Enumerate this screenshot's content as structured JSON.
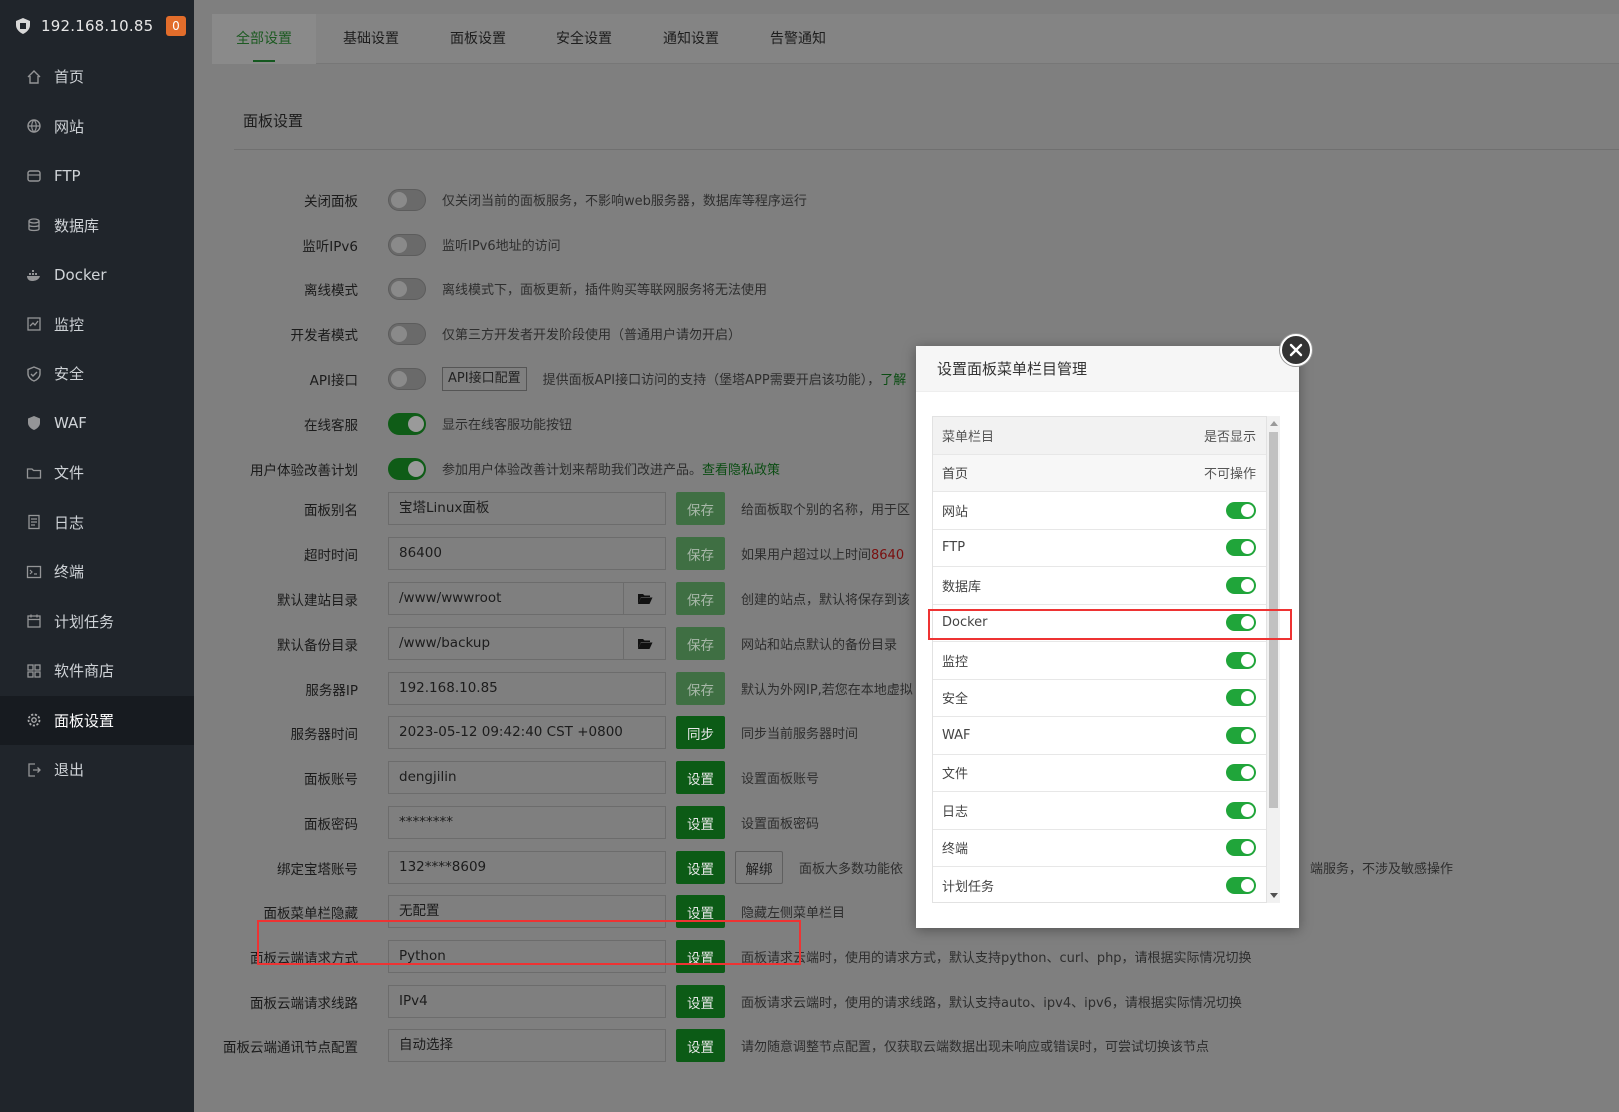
{
  "sidebar": {
    "host": "192.168.10.85",
    "badge": "0",
    "items": [
      {
        "label": "首页",
        "icon": "home-icon"
      },
      {
        "label": "网站",
        "icon": "globe-icon"
      },
      {
        "label": "FTP",
        "icon": "ftp-icon"
      },
      {
        "label": "数据库",
        "icon": "database-icon"
      },
      {
        "label": "Docker",
        "icon": "docker-icon"
      },
      {
        "label": "监控",
        "icon": "monitor-icon"
      },
      {
        "label": "安全",
        "icon": "shield-icon"
      },
      {
        "label": "WAF",
        "icon": "waf-icon"
      },
      {
        "label": "文件",
        "icon": "folder-icon"
      },
      {
        "label": "日志",
        "icon": "log-icon"
      },
      {
        "label": "终端",
        "icon": "terminal-icon"
      },
      {
        "label": "计划任务",
        "icon": "calendar-icon"
      },
      {
        "label": "软件商店",
        "icon": "apps-icon"
      },
      {
        "label": "面板设置",
        "icon": "gear-icon"
      },
      {
        "label": "退出",
        "icon": "logout-icon"
      }
    ]
  },
  "tabs": [
    "全部设置",
    "基础设置",
    "面板设置",
    "安全设置",
    "通知设置",
    "告警通知"
  ],
  "panel": {
    "title": "面板设置",
    "toggles": [
      {
        "label": "关闭面板",
        "on": false,
        "desc": "仅关闭当前的面板服务，不影响web服务器，数据库等程序运行"
      },
      {
        "label": "监听IPv6",
        "on": false,
        "desc": "监听IPv6地址的访问"
      },
      {
        "label": "离线模式",
        "on": false,
        "desc": "离线模式下，面板更新，插件购买等联网服务将无法使用"
      },
      {
        "label": "开发者模式",
        "on": false,
        "desc": "仅第三方开发者开发阶段使用（普通用户请勿开启）"
      },
      {
        "label": "API接口",
        "on": false,
        "btn": "API接口配置",
        "desc": "提供面板API接口访问的支持（堡塔APP需要开启该功能），",
        "link": "了解"
      },
      {
        "label": "在线客服",
        "on": true,
        "desc": "显示在线客服功能按钮"
      },
      {
        "label": "用户体验改善计划",
        "on": true,
        "desc": "参加用户体验改善计划来帮助我们改进产品。",
        "link": "查看隐私政策"
      }
    ],
    "fields": [
      {
        "label": "面板别名",
        "value": "宝塔Linux面板",
        "btn": "保存",
        "desc": "给面板取个别的名称，用于区"
      },
      {
        "label": "超时时间",
        "value": "86400",
        "btn": "保存",
        "desc": "如果用户超过以上时间",
        "red": "8640"
      },
      {
        "label": "默认建站目录",
        "value": "/www/wwwroot",
        "btn": "保存",
        "desc": "创建的站点，默认将保存到该"
      },
      {
        "label": "默认备份目录",
        "value": "/www/backup",
        "btn": "保存",
        "desc": "网站和站点默认的备份目录"
      },
      {
        "label": "服务器IP",
        "value": "192.168.10.85",
        "btn": "保存",
        "desc": "默认为外网IP,若您在本地虚拟"
      },
      {
        "label": "服务器时间",
        "value": "2023-05-12 09:42:40 CST +0800",
        "btn": "同步",
        "desc": "同步当前服务器时间"
      },
      {
        "label": "面板账号",
        "value": "dengjilin",
        "btn": "设置",
        "desc": "设置面板账号"
      },
      {
        "label": "面板密码",
        "value": "********",
        "btn": "设置",
        "desc": "设置面板密码"
      },
      {
        "label": "绑定宝塔账号",
        "value": "132****8609",
        "btn": "设置",
        "btn2": "解绑",
        "desc": "面板大多数功能依",
        "desc_tail": "端服务，不涉及敏感操作"
      },
      {
        "label": "面板菜单栏隐藏",
        "value": "无配置",
        "btn": "设置",
        "desc": "隐藏左侧菜单栏目"
      },
      {
        "label": "面板云端请求方式",
        "value": "Python",
        "btn": "设置",
        "desc": "面板请求云端时，使用的请求方式，默认支持python、curl、php，请根据实际情况切换"
      },
      {
        "label": "面板云端请求线路",
        "value": "IPv4",
        "btn": "设置",
        "desc": "面板请求云端时，使用的请求线路，默认支持auto、ipv4、ipv6，请根据实际情况切换"
      },
      {
        "label": "面板云端通讯节点配置",
        "value": "自动选择",
        "btn": "设置",
        "desc": "请勿随意调整节点配置，仅获取云端数据出现未响应或错误时，可尝试切换该节点"
      }
    ]
  },
  "modal": {
    "title": "设置面板菜单栏目管理",
    "head": {
      "left": "菜单栏目",
      "right": "是否显示"
    },
    "first": {
      "left": "首页",
      "right": "不可操作"
    },
    "rows": [
      "网站",
      "FTP",
      "数据库",
      "Docker",
      "监控",
      "安全",
      "WAF",
      "文件",
      "日志",
      "终端",
      "计划任务"
    ]
  }
}
